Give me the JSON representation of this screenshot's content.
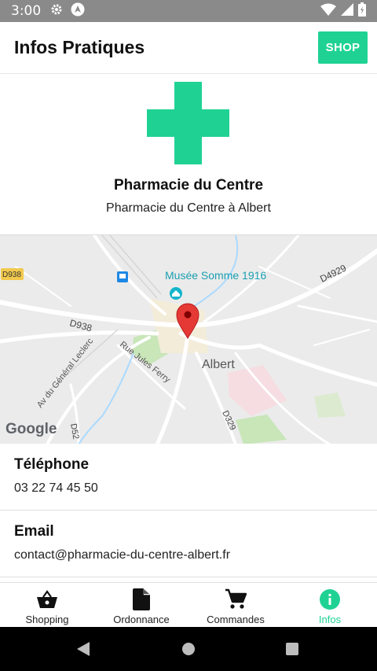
{
  "status_bar": {
    "time": "3:00",
    "icons_left": [
      "gear-icon",
      "navigation-a-icon"
    ],
    "icons_right": [
      "wifi-icon",
      "signal-icon",
      "battery-icon"
    ]
  },
  "app_bar": {
    "title": "Infos Pratiques",
    "shop_label": "SHOP"
  },
  "pharmacy": {
    "logo_icon": "pharmacy-cross-icon",
    "name": "Pharmacie du Centre",
    "subtitle": "Pharmacie du Centre à Albert"
  },
  "map": {
    "labels": {
      "d938_badge": "D938",
      "museum": "Musée Somme 1916",
      "d4929": "D4929",
      "d938_road": "D938",
      "rue_jules_ferry": "Rue Jules Ferry",
      "av_general": "Av du Général Leclerc",
      "albert": "Albert",
      "d52": "D52",
      "d329": "D329",
      "google": "Google"
    }
  },
  "telephone": {
    "title": "Téléphone",
    "value": "03 22 74 45 50"
  },
  "email": {
    "title": "Email",
    "value": "contact@pharmacie-du-centre-albert.fr"
  },
  "bottom_nav": {
    "items": [
      {
        "label": "Shopping",
        "icon": "basket-icon",
        "active": false
      },
      {
        "label": "Ordonnance",
        "icon": "document-icon",
        "active": false
      },
      {
        "label": "Commandes",
        "icon": "cart-icon",
        "active": false
      },
      {
        "label": "Infos",
        "icon": "info-icon",
        "active": true
      }
    ]
  },
  "colors": {
    "accent": "#1fd294",
    "status_bar": "#8a8a8a",
    "system_nav": "#000000",
    "map_background": "#ebebeb",
    "map_pin": "#e53935"
  }
}
